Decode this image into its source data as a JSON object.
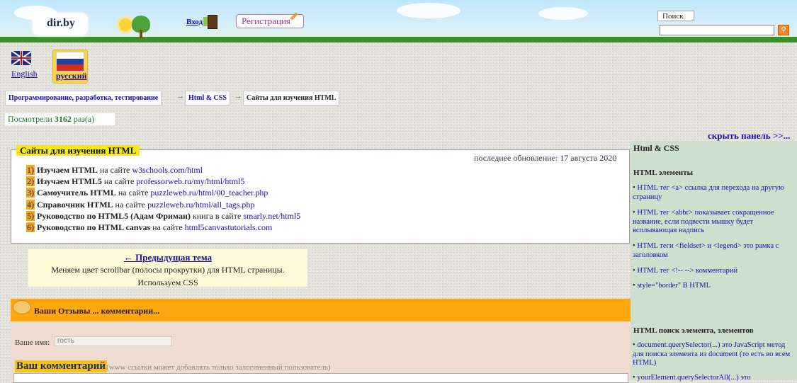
{
  "header": {
    "logo": "dir.by",
    "login_label": "Вход",
    "register_label": "Регистрация",
    "search_label": "Поиск",
    "search_value": "",
    "search_icon": "search-icon"
  },
  "languages": {
    "en_label": "English",
    "ru_label": "русский"
  },
  "breadcrumb": {
    "item1": "Программирование, разработка, тестирование",
    "item2": "Html & CSS",
    "item3": "Сайты для изучения HTML",
    "separator": "→"
  },
  "views": {
    "prefix": "Посмотрели",
    "count": "3162",
    "suffix": "раз(а)"
  },
  "hide_panel": "скрыть панель >>...",
  "article": {
    "title": "Сайты для изучения HTML",
    "updated": "последнее обновление: 17 августа 2020",
    "items": [
      {
        "num": "1)",
        "bold": "Изучаем HTML",
        "mid": " на сайте ",
        "link": "w3schools.com/html"
      },
      {
        "num": "2)",
        "bold": "Изучаем HTML5",
        "mid": " на сайте ",
        "link": "professorweb.ru/my/html/html5"
      },
      {
        "num": "3)",
        "bold": "Самоучитель HTML",
        "mid": " на сайте ",
        "link": "puzzleweb.ru/html/00_teacher.php"
      },
      {
        "num": "4)",
        "bold": "Справочник HTML",
        "mid": " на сайте ",
        "link": "puzzleweb.ru/html/all_tags.php"
      },
      {
        "num": "5)",
        "bold": "Руководство по HTML5 (Адам Фриман)",
        "mid": " книга в сайте ",
        "link": "smarly.net/html5"
      },
      {
        "num": "6)",
        "bold": "Руководство по HTML canvas",
        "mid": " на сайте ",
        "link": "html5canvastutorials.com"
      }
    ]
  },
  "prev_topic": {
    "link": "← Предыдущая тема",
    "desc1": "Меняем цвет scrollbar (полосы прокрутки) для HTML страницы.",
    "desc2": "Используем CSS"
  },
  "comments": {
    "title": "Ваши Отзывы ... комментарии...",
    "name_label": "Ваше имя:",
    "name_placeholder": "гость",
    "comment_label": "Ваш комментарий",
    "comment_note": "(www ссылки может добавлять только залогиненный пользователь)"
  },
  "sidebar": {
    "title": "Html & CSS",
    "section1": "HTML элементы",
    "items1": [
      "HTML тег <a> ссылка для перехода на другую страницу",
      "HTML тег <abbr> показывает сокращенное название, если подвести мышку будет всплывающая надпись",
      "HTML теги <fieldset> и <legend> это рамка с заголовком",
      "HTML тег <!-- --> комментарий",
      "style=\"border\" В HTML"
    ],
    "section2": "HTML поиск элемента, элементов",
    "items2": [
      "document.querySelector(...) это JavaScript метод для поиска элемента из document (то есть во всем HTML)",
      "yourElement.querySelectorAll(...) это"
    ],
    "bullet": "•"
  },
  "colors": {
    "legend_bg": "#f4e91f",
    "comments_bar": "#ffa70d",
    "sidebar_bg": "#cfdfcd",
    "link": "#1a0dab"
  }
}
